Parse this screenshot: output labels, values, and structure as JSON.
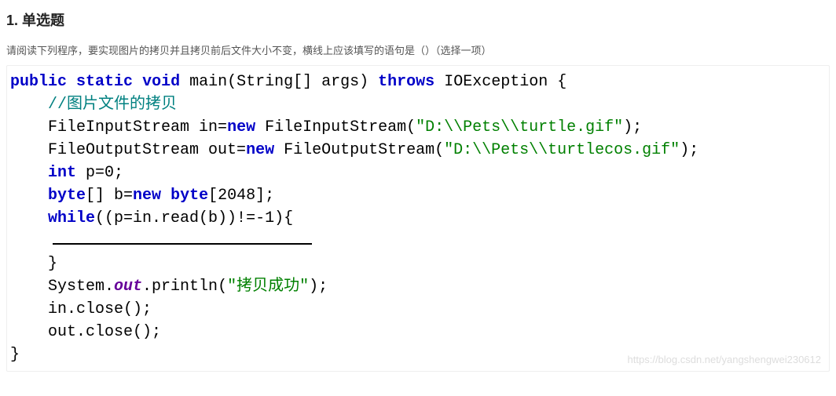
{
  "header": {
    "title": "1. 单选题"
  },
  "question": {
    "desc": "请阅读下列程序，要实现图片的拷贝并且拷贝前后文件大小不变，横线上应该填写的语句是（）（选择一项）"
  },
  "code": {
    "kw_public": "public",
    "kw_static": "static",
    "kw_void": "void",
    "main": "main",
    "args": "(String[] args)",
    "kw_throws": "throws",
    "io_exception": "IOException {",
    "comment1": "//图片文件的拷贝",
    "fis_decl_a": "FileInputStream in=",
    "kw_new1": "new",
    "fis_decl_b": " FileInputStream(",
    "str1": "\"D:\\\\Pets\\\\turtle.gif\"",
    "fis_decl_c": ");",
    "fos_decl_a": "FileOutputStream out=",
    "kw_new2": "new",
    "fos_decl_b": " FileOutputStream(",
    "str2": "\"D:\\\\Pets\\\\turtlecos.gif\"",
    "fos_decl_c": ");",
    "kw_int": "int",
    "int_line": " p=0;",
    "kw_byte": "byte",
    "byte_a": "[] b=",
    "kw_new3": "new",
    "kw_byte2": "byte",
    "byte_b": "[2048];",
    "kw_while": "while",
    "while_cond": "((p=in.read(b))!=-1){",
    "close_brace1": "}",
    "sys": "System.",
    "out_field": "out",
    "println_a": ".println(",
    "str3": "\"拷贝成功\"",
    "println_b": ");",
    "inclose": "in.close();",
    "outclose": "out.close();",
    "close_brace2": "}"
  },
  "watermark": "https://blog.csdn.net/yangshengwei230612"
}
